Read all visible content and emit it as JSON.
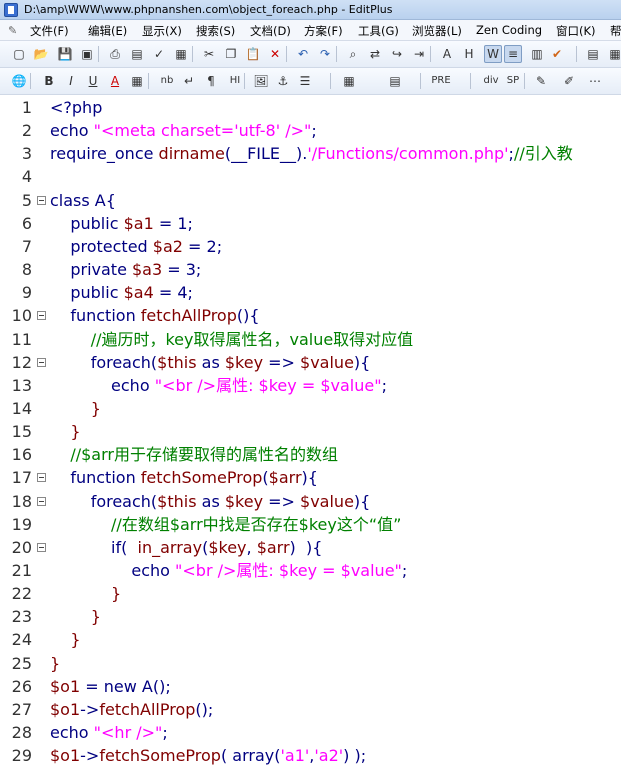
{
  "window": {
    "title": "D:\\amp\\WWW\\www.phpnanshen.com\\object_foreach.php - EditPlus"
  },
  "menu": [
    "文件(F)",
    "编辑(E)",
    "显示(X)",
    "搜索(S)",
    "文档(D)",
    "方案(F)",
    "工具(G)",
    "浏览器(L)",
    "Zen Coding",
    "窗口(K)",
    "帮"
  ],
  "toolbar1": [
    "new-file",
    "open-file",
    "save",
    "save-all",
    "print",
    "print-preview",
    "spell-check",
    "find-in-files",
    "cut",
    "copy",
    "paste",
    "delete",
    "undo",
    "redo",
    "find",
    "replace",
    "goto",
    "indent",
    "font",
    "heading",
    "word-wrap",
    "line-numbers",
    "column",
    "check"
  ],
  "toolbar2": [
    "globe",
    "bold",
    "italic",
    "underline",
    "font-color",
    "color-grid",
    "nbsp",
    "br",
    "paragraph",
    "hr",
    "image",
    "anchor",
    "list",
    "table",
    "form",
    "pre",
    "div",
    "sp",
    "edit",
    "tools",
    "more"
  ],
  "toolbar2_labels": {
    "bold": "B",
    "italic": "I",
    "underline": "U",
    "nb": "nb",
    "hr": "HI",
    "pre": "PRE",
    "div": "div",
    "sp": "SP"
  },
  "code_lines": [
    {
      "n": "1",
      "fold": false,
      "parts": [
        [
          "p",
          "<?php"
        ]
      ]
    },
    {
      "n": "2",
      "fold": false,
      "parts": [
        [
          "k",
          "echo "
        ],
        [
          "s",
          "\"<meta charset='utf-8' />\""
        ],
        [
          "k",
          ";"
        ]
      ]
    },
    {
      "n": "3",
      "fold": false,
      "parts": [
        [
          "k",
          "require_once "
        ],
        [
          "f",
          "dirname"
        ],
        [
          "k",
          "(__FILE__)."
        ],
        [
          "s",
          "'/Functions/common.php'"
        ],
        [
          "k",
          ";"
        ],
        [
          "c",
          "//引入教"
        ]
      ]
    },
    {
      "n": "4",
      "fold": false,
      "parts": []
    },
    {
      "n": "5",
      "fold": true,
      "parts": [
        [
          "k",
          "class A{"
        ]
      ]
    },
    {
      "n": "6",
      "fold": false,
      "parts": [
        [
          "k",
          "    public "
        ],
        [
          "d",
          "$a1"
        ],
        [
          "k",
          " = 1;"
        ]
      ]
    },
    {
      "n": "7",
      "fold": false,
      "parts": [
        [
          "k",
          "    protected "
        ],
        [
          "d",
          "$a2"
        ],
        [
          "k",
          " = 2;"
        ]
      ]
    },
    {
      "n": "8",
      "fold": false,
      "parts": [
        [
          "k",
          "    private "
        ],
        [
          "d",
          "$a3"
        ],
        [
          "k",
          " = 3;"
        ]
      ]
    },
    {
      "n": "9",
      "fold": false,
      "parts": [
        [
          "k",
          "    public "
        ],
        [
          "d",
          "$a4"
        ],
        [
          "k",
          " = 4;"
        ]
      ]
    },
    {
      "n": "10",
      "fold": true,
      "parts": [
        [
          "k",
          "    function "
        ],
        [
          "f",
          "fetchAllProp"
        ],
        [
          "k",
          "(){"
        ]
      ]
    },
    {
      "n": "11",
      "fold": false,
      "parts": [
        [
          "c",
          "        //遍历时，key取得属性名，value取得对应值"
        ]
      ]
    },
    {
      "n": "12",
      "fold": true,
      "parts": [
        [
          "k",
          "        foreach("
        ],
        [
          "d",
          "$this"
        ],
        [
          "k",
          " as "
        ],
        [
          "d",
          "$key"
        ],
        [
          "k",
          " => "
        ],
        [
          "d",
          "$value"
        ],
        [
          "k",
          "){"
        ]
      ]
    },
    {
      "n": "13",
      "fold": false,
      "parts": [
        [
          "k",
          "            echo "
        ],
        [
          "s",
          "\"<br />属性: $key = $value\""
        ],
        [
          "k",
          ";"
        ]
      ]
    },
    {
      "n": "14",
      "fold": false,
      "parts": [
        [
          "d",
          "        }"
        ]
      ]
    },
    {
      "n": "15",
      "fold": false,
      "parts": [
        [
          "d",
          "    }"
        ]
      ]
    },
    {
      "n": "16",
      "fold": false,
      "parts": [
        [
          "c",
          "    //$arr用于存储要取得的属性名的数组"
        ]
      ]
    },
    {
      "n": "17",
      "fold": true,
      "parts": [
        [
          "k",
          "    function "
        ],
        [
          "f",
          "fetchSomeProp"
        ],
        [
          "k",
          "("
        ],
        [
          "d",
          "$arr"
        ],
        [
          "k",
          "){"
        ]
      ]
    },
    {
      "n": "18",
      "fold": true,
      "parts": [
        [
          "k",
          "        foreach("
        ],
        [
          "d",
          "$this"
        ],
        [
          "k",
          " as "
        ],
        [
          "d",
          "$key"
        ],
        [
          "k",
          " => "
        ],
        [
          "d",
          "$value"
        ],
        [
          "k",
          "){"
        ]
      ]
    },
    {
      "n": "19",
      "fold": false,
      "parts": [
        [
          "c",
          "            //在数组$arr中找是否存在$key这个“值”"
        ]
      ]
    },
    {
      "n": "20",
      "fold": true,
      "parts": [
        [
          "k",
          "            if(  "
        ],
        [
          "f",
          "in_array"
        ],
        [
          "k",
          "("
        ],
        [
          "d",
          "$key"
        ],
        [
          "k",
          ", "
        ],
        [
          "d",
          "$arr"
        ],
        [
          "k",
          ")  ){"
        ]
      ]
    },
    {
      "n": "21",
      "fold": false,
      "parts": [
        [
          "k",
          "                echo "
        ],
        [
          "s",
          "\"<br />属性: $key = $value\""
        ],
        [
          "k",
          ";"
        ]
      ]
    },
    {
      "n": "22",
      "fold": false,
      "parts": [
        [
          "d",
          "            }"
        ]
      ]
    },
    {
      "n": "23",
      "fold": false,
      "parts": [
        [
          "d",
          "        }"
        ]
      ]
    },
    {
      "n": "24",
      "fold": false,
      "parts": [
        [
          "d",
          "    }"
        ]
      ]
    },
    {
      "n": "25",
      "fold": false,
      "parts": [
        [
          "d",
          "}"
        ]
      ]
    },
    {
      "n": "26",
      "fold": false,
      "parts": [
        [
          "d",
          "$o1"
        ],
        [
          "k",
          " = new A();"
        ]
      ]
    },
    {
      "n": "27",
      "fold": false,
      "parts": [
        [
          "d",
          "$o1"
        ],
        [
          "k",
          "->"
        ],
        [
          "f",
          "fetchAllProp"
        ],
        [
          "k",
          "();"
        ]
      ]
    },
    {
      "n": "28",
      "fold": false,
      "parts": [
        [
          "k",
          "echo "
        ],
        [
          "s",
          "\"<hr />\""
        ],
        [
          "k",
          ";"
        ]
      ]
    },
    {
      "n": "29",
      "fold": false,
      "parts": [
        [
          "d",
          "$o1"
        ],
        [
          "k",
          "->"
        ],
        [
          "f",
          "fetchSomeProp"
        ],
        [
          "k",
          "( array("
        ],
        [
          "s",
          "'a1'"
        ],
        [
          "k",
          ","
        ],
        [
          "s",
          "'a2'"
        ],
        [
          "k",
          ") );"
        ]
      ]
    }
  ]
}
